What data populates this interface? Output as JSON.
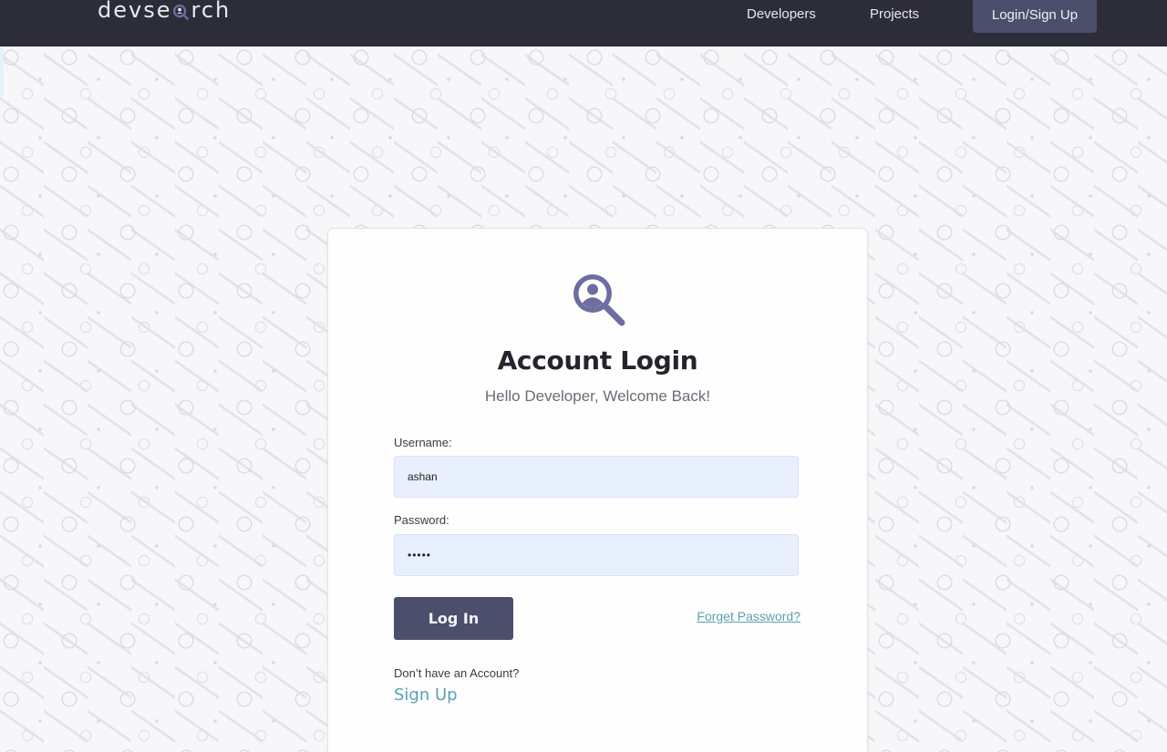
{
  "header": {
    "logo_left": "devse",
    "logo_right": "rch",
    "nav": {
      "developers": "Developers",
      "projects": "Projects",
      "login_signup": "Login/Sign Up"
    }
  },
  "login_card": {
    "title": "Account Login",
    "subtitle": "Hello Developer, Welcome Back!",
    "username_label": "Username:",
    "username_value": "ashan",
    "password_label": "Password:",
    "password_value": "•••••",
    "login_button": "Log In",
    "forgot_password": "Forget Password?",
    "no_account_text": "Don’t have an Account?",
    "signup_link": "Sign Up"
  },
  "colors": {
    "navbar": "#2d2d39",
    "primary": "#4c4f6b",
    "accent_link": "#5aa1b2",
    "input_bg": "#e8f0fd",
    "page_bg": "#f7f7f9"
  },
  "icons": {
    "logo_glyph": "search-person-icon",
    "card_icon": "search-person-icon"
  }
}
